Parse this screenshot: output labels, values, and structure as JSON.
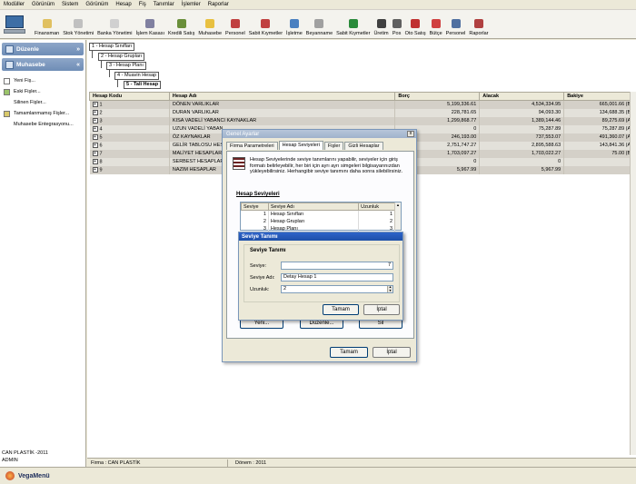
{
  "menu": [
    "Modüller",
    "Görünüm",
    "Sistem",
    "Görünüm",
    "Hesap",
    "Fiş",
    "Tanımlar",
    "İşlemler",
    "Raporlar"
  ],
  "toolbar": [
    {
      "label": "Finansman",
      "icon": "finance-icon",
      "color": "#e0c060"
    },
    {
      "label": "Stok Yönetimi",
      "icon": "stock-icon",
      "color": "#c0c0c0"
    },
    {
      "label": "Banka Yönetimi",
      "icon": "bank-icon",
      "color": "#d0d0d0"
    },
    {
      "label": "İşlem Kasası",
      "icon": "cashbox-icon",
      "color": "#8080a0"
    },
    {
      "label": "Kredili Satış",
      "icon": "credit-sale-icon",
      "color": "#6a8f3a"
    },
    {
      "label": "Muhasebe",
      "icon": "accounting-icon",
      "color": "#e8c040"
    },
    {
      "label": "Personel",
      "icon": "staff-icon",
      "color": "#c04040"
    },
    {
      "label": "Sabit Kıymetler",
      "icon": "fixed-assets-icon",
      "color": "#c04040"
    },
    {
      "label": "İşletme",
      "icon": "business-icon",
      "color": "#4a80c0"
    },
    {
      "label": "Beyanname",
      "icon": "declaration-icon",
      "color": "#a0a0a0"
    },
    {
      "label": "Sabit Kıymetler",
      "icon": "fixed-assets-icon",
      "color": "#2a8a3a"
    },
    {
      "label": "Üretim",
      "icon": "production-icon",
      "color": "#404040"
    },
    {
      "label": "Pos",
      "icon": "pos-icon",
      "color": "#606060"
    },
    {
      "label": "Oto Satış",
      "icon": "auto-sale-icon",
      "color": "#c03030"
    },
    {
      "label": "Bütçe",
      "icon": "budget-icon",
      "color": "#d04040"
    },
    {
      "label": "Personel",
      "icon": "staff-icon",
      "color": "#5070a0"
    },
    {
      "label": "Raporlar",
      "icon": "reports-icon",
      "color": "#b04040"
    }
  ],
  "left": {
    "duzenle": "Düzenle",
    "muhasebe": "Muhasebe",
    "items": [
      "Yeni Fiş...",
      "Eski Fişler...",
      "Silinen Fişler...",
      "Tamamlanmamış Fişler...",
      "Muhasebe Entegrasyonu..."
    ],
    "company": "CAN PLASTİK -2011",
    "user": "ADMIN"
  },
  "tree": [
    "1 - Hesap Sınıfları",
    "2 - Hesap Grupları",
    "3 - Hesap   Planı",
    "4 - Muavin Hesap",
    "5 - Tali Hesap"
  ],
  "grid": {
    "headers": [
      "Hesap Kodu",
      "Hesap Adı",
      "Borç",
      "Alacak",
      "Bakiye"
    ],
    "rows": [
      {
        "code": "1",
        "name": "DÖNEN VARLIKLAR",
        "borc": "5,199,336.61",
        "alacak": "4,534,334.95",
        "bakiye": "665,001.66 (B)"
      },
      {
        "code": "2",
        "name": "DURAN VARLIKLAR",
        "borc": "228,781.65",
        "alacak": "94,093.30",
        "bakiye": "134,688.35 (B)"
      },
      {
        "code": "3",
        "name": "KISA VADELİ YABANCI KAYNAKLAR",
        "borc": "1,299,868.77",
        "alacak": "1,389,144.46",
        "bakiye": "89,275.69 (A)"
      },
      {
        "code": "4",
        "name": "UZUN VADELİ YABAN",
        "borc": "0",
        "alacak": "75,287.89",
        "bakiye": "75,287.89 (A)"
      },
      {
        "code": "5",
        "name": "ÖZ KAYNAKLAR",
        "borc": "246,193.00",
        "alacak": "737,553.07",
        "bakiye": "491,360.07 (A)"
      },
      {
        "code": "6",
        "name": "GELİR TABLOSU HES",
        "borc": "2,751,747.27",
        "alacak": "2,895,588.63",
        "bakiye": "143,841.36 (A)"
      },
      {
        "code": "7",
        "name": "MALİYET HESAPLARI",
        "borc": "1,703,097.27",
        "alacak": "1,703,022.27",
        "bakiye": "75.00 (B)"
      },
      {
        "code": "8",
        "name": "SERBEST HESAPLAR",
        "borc": "0",
        "alacak": "0",
        "bakiye": "0"
      },
      {
        "code": "9",
        "name": "NAZIM HESAPLAR",
        "borc": "5,967.99",
        "alacak": "5,967.99",
        "bakiye": "0"
      }
    ]
  },
  "status": {
    "firma": "Firma : CAN PLASTİK",
    "donem": "Dönem : 2011"
  },
  "bottom": {
    "label": "VegaMenü"
  },
  "dialog": {
    "title": "Genel Ayarlar",
    "close": "x",
    "tabs": [
      "Firma Parametreleri",
      "Hesap Seviyeleri",
      "Fişler",
      "Gizli Hesaplar"
    ],
    "info": "Hesap Seviyelerinde seviye tanımlarını yapabilir, seviyeler için giriş formatı belirleyebilir, her biri için ayrı ayrı simgeleri bilgisayarınızdan yükleyebilirsiniz. Herhangibir seviye tanımını daha sonra silebilirsiniz.",
    "group": "Hesap Seviyeleri",
    "list_headers": [
      "Seviye",
      "Seviye Adı",
      "Uzunluk"
    ],
    "list_rows": [
      {
        "seviye": "1",
        "adi": "Hesap Sınıfları",
        "uzunluk": "1"
      },
      {
        "seviye": "2",
        "adi": "Hesap Grupları",
        "uzunluk": "2"
      },
      {
        "seviye": "3",
        "adi": "Hesap   Planı",
        "uzunluk": "3"
      }
    ],
    "yeni": "Yeni...",
    "duzenle": "Düzenle...",
    "sil": "Sil",
    "tamam": "Tamam",
    "iptal": "İptal"
  },
  "subdialog": {
    "title": "Seviye Tanımı",
    "group": "Seviye Tanımı",
    "seviye_label": "Seviye:",
    "seviye_value": "7",
    "adi_label": "Seviye Adı:",
    "adi_value": "Detay Hesap 1",
    "uzunluk_label": "Uzunluk:",
    "uzunluk_value": "2",
    "tamam": "Tamam",
    "iptal": "İptal"
  }
}
